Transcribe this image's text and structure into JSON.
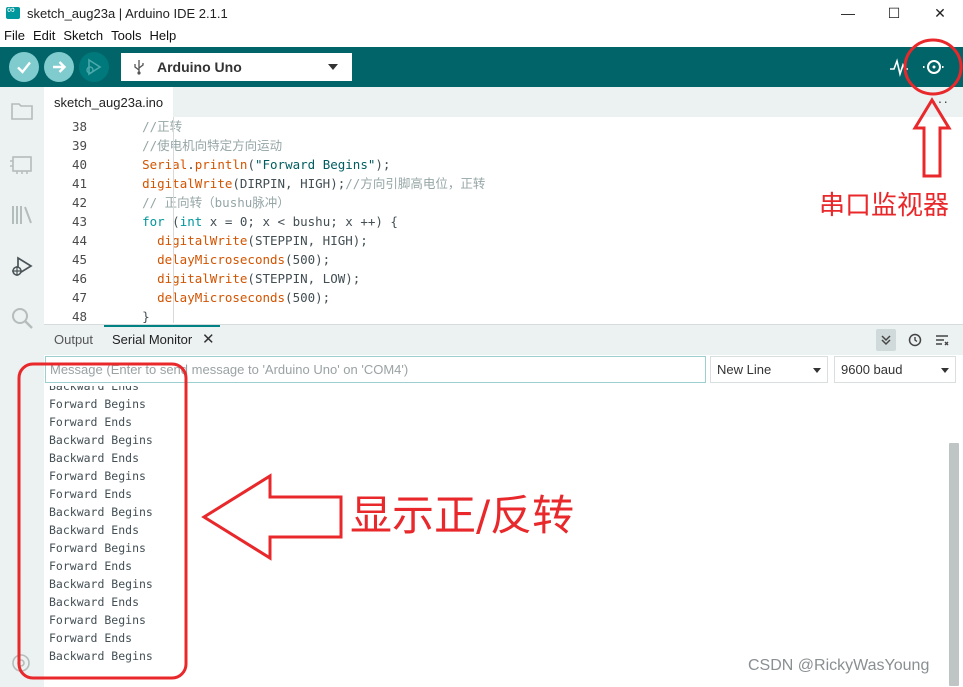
{
  "window": {
    "title": "sketch_aug23a | Arduino IDE 2.1.1",
    "controls": [
      "—",
      "☐",
      "✕"
    ]
  },
  "menu": [
    "File",
    "Edit",
    "Sketch",
    "Tools",
    "Help"
  ],
  "toolbar": {
    "board": "Arduino Uno",
    "icons": [
      "verify-icon",
      "upload-icon",
      "debug-icon",
      "usb-icon",
      "serial-plotter-icon",
      "serial-monitor-icon"
    ],
    "accent_color": "#006468"
  },
  "editor": {
    "tab": "sketch_aug23a.ino",
    "more": "···",
    "lines": [
      {
        "n": "38",
        "indent": "  ",
        "parts": [
          {
            "t": "//正转",
            "c": "comment"
          }
        ]
      },
      {
        "n": "39",
        "indent": "  ",
        "parts": [
          {
            "t": "//使电机向特定方向运动",
            "c": "comment"
          }
        ]
      },
      {
        "n": "40",
        "indent": "  ",
        "parts": [
          {
            "t": "Serial",
            "c": "func"
          },
          {
            "t": ".",
            "c": ""
          },
          {
            "t": "println",
            "c": "func"
          },
          {
            "t": "(",
            "c": ""
          },
          {
            "t": "\"Forward Begins\"",
            "c": "str"
          },
          {
            "t": ");",
            "c": ""
          }
        ]
      },
      {
        "n": "41",
        "indent": "  ",
        "parts": [
          {
            "t": "digitalWrite",
            "c": "func"
          },
          {
            "t": "(DIRPIN, HIGH);",
            "c": ""
          },
          {
            "t": "//方向引脚高电位，正转",
            "c": "comment"
          }
        ]
      },
      {
        "n": "42",
        "indent": "  ",
        "parts": [
          {
            "t": "// 正向转（bushu脉冲）",
            "c": "comment"
          }
        ]
      },
      {
        "n": "43",
        "indent": "  ",
        "parts": [
          {
            "t": "for",
            "c": "kw"
          },
          {
            "t": " (",
            "c": ""
          },
          {
            "t": "int",
            "c": "kw"
          },
          {
            "t": " x = 0; x < bushu; x ++) {",
            "c": ""
          }
        ]
      },
      {
        "n": "44",
        "indent": "    ",
        "parts": [
          {
            "t": "digitalWrite",
            "c": "func"
          },
          {
            "t": "(STEPPIN, HIGH);",
            "c": ""
          }
        ]
      },
      {
        "n": "45",
        "indent": "    ",
        "parts": [
          {
            "t": "delayMicroseconds",
            "c": "func"
          },
          {
            "t": "(500);",
            "c": ""
          }
        ]
      },
      {
        "n": "46",
        "indent": "    ",
        "parts": [
          {
            "t": "digitalWrite",
            "c": "func"
          },
          {
            "t": "(STEPPIN, LOW);",
            "c": ""
          }
        ]
      },
      {
        "n": "47",
        "indent": "    ",
        "parts": [
          {
            "t": "delayMicroseconds",
            "c": "func"
          },
          {
            "t": "(500);",
            "c": ""
          }
        ]
      },
      {
        "n": "48",
        "indent": "  ",
        "parts": [
          {
            "t": "}",
            "c": ""
          }
        ]
      }
    ]
  },
  "panel": {
    "tabs": [
      "Output",
      "Serial Monitor"
    ],
    "close": "✕",
    "message_placeholder": "Message (Enter to send message to 'Arduino Uno' on 'COM4')",
    "line_ending": "New Line",
    "baud": "9600 baud",
    "output_lines": [
      "Backward Ends",
      "Forward Begins",
      "Forward Ends",
      "Backward Begins",
      "Backward Ends",
      "Forward Begins",
      "Forward Ends",
      "Backward Begins",
      "Backward Ends",
      "Forward Begins",
      "Forward Ends",
      "Backward Begins",
      "Backward Ends",
      "Forward Begins",
      "Forward Ends",
      "Backward Begins"
    ]
  },
  "annotations": {
    "serial_monitor_label": "串口监视器",
    "direction_label": "显示正/反转",
    "color": "#e8282b"
  },
  "watermark": "CSDN @RickyWasYoung"
}
